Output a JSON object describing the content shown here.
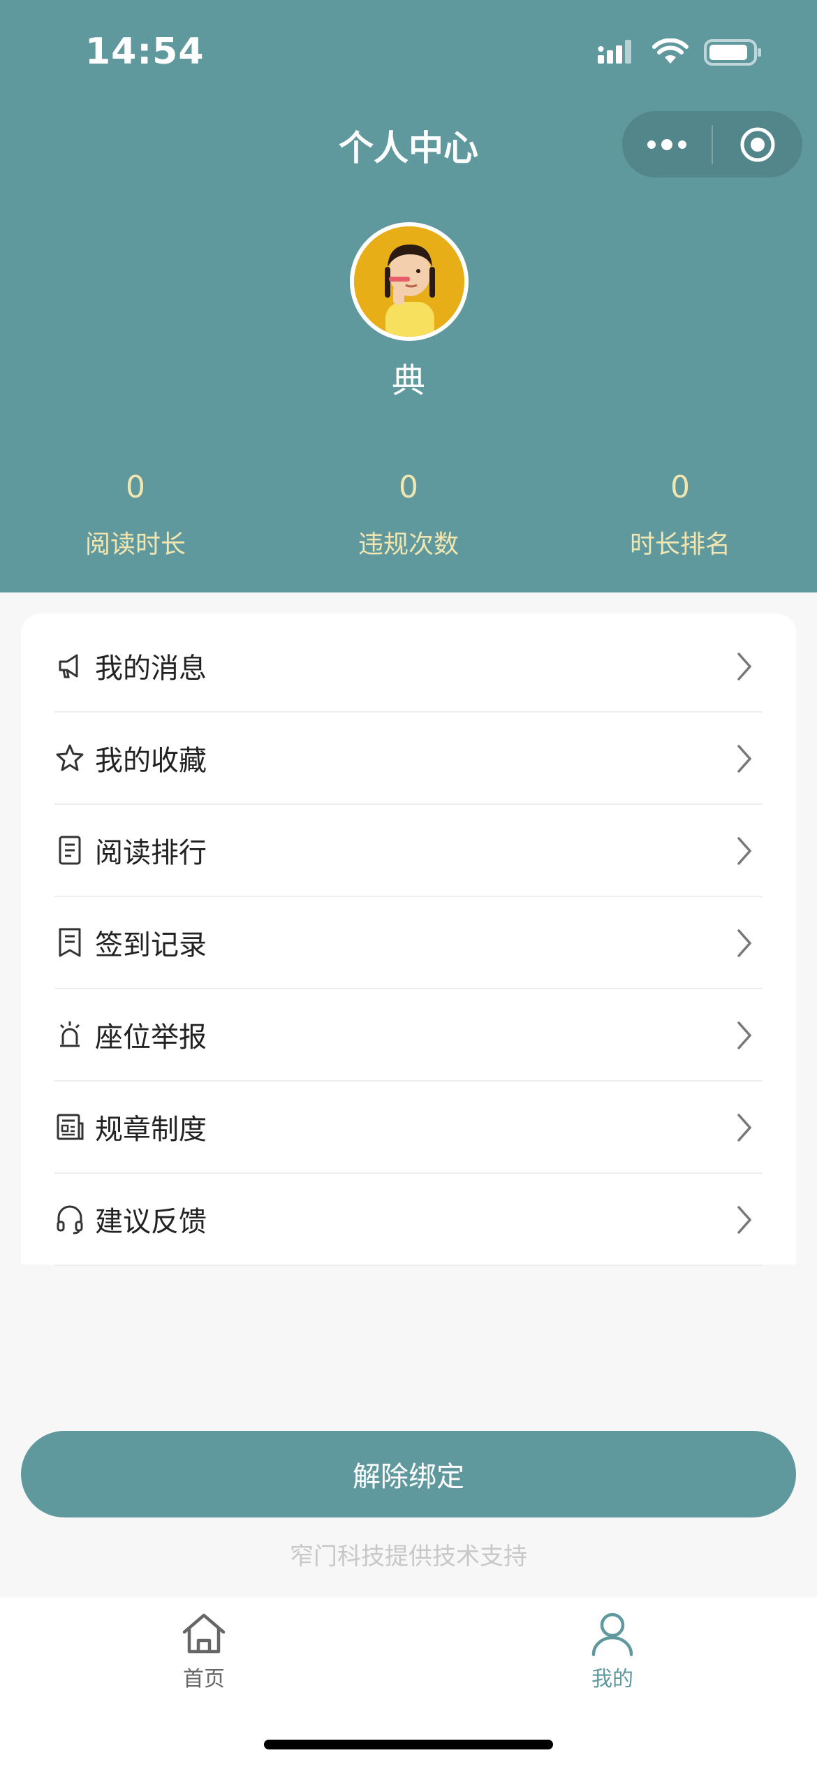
{
  "status_bar": {
    "time": "14:54"
  },
  "header": {
    "title": "个人中心",
    "username": "典"
  },
  "stats": [
    {
      "value": "0",
      "label": "阅读时长"
    },
    {
      "value": "0",
      "label": "违规次数"
    },
    {
      "value": "0",
      "label": "时长排名"
    }
  ],
  "menu": [
    {
      "label": "我的消息",
      "icon": "megaphone-icon"
    },
    {
      "label": "我的收藏",
      "icon": "star-icon"
    },
    {
      "label": "阅读排行",
      "icon": "document-icon"
    },
    {
      "label": "签到记录",
      "icon": "record-icon"
    },
    {
      "label": "座位举报",
      "icon": "alarm-icon"
    },
    {
      "label": "规章制度",
      "icon": "newspaper-icon"
    },
    {
      "label": "建议反馈",
      "icon": "headset-icon"
    }
  ],
  "unbind_button": "解除绑定",
  "support_text": "窄门科技提供技术支持",
  "tabbar": [
    {
      "label": "首页",
      "icon": "home-icon",
      "active": false
    },
    {
      "label": "我的",
      "icon": "user-icon",
      "active": true
    }
  ],
  "colors": {
    "primary": "#5f999e",
    "stat_text": "#f2e6b0",
    "avatar_bg": "#e8ae18"
  }
}
